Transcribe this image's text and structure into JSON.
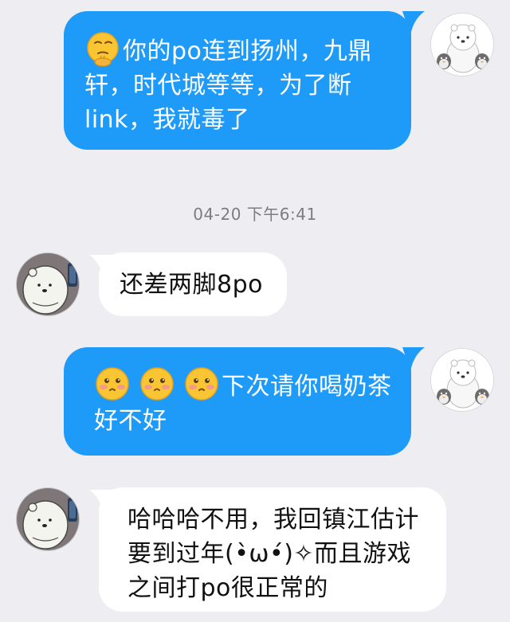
{
  "chat": {
    "timestamp": "04-20 下午6:41",
    "messages": [
      {
        "side": "out",
        "emoji_icon": "thinking-chin-emoji",
        "text": "你的po连到扬州，九鼎轩，时代城等等，为了断link，我就毒了"
      },
      {
        "side": "in",
        "text": "还差两脚8po"
      },
      {
        "side": "out",
        "emoji_icon": "blushing-face-emoji",
        "emoji_count": 3,
        "text": "下次请你喝奶茶好不好"
      },
      {
        "side": "in",
        "text": "哈哈哈不用，我回镇江估计要到过年(•̀ω•́)✧而且游戏之间打po很正常的"
      }
    ],
    "avatars": {
      "self": "polar-bear-penguins-avatar",
      "other": "ice-bear-avatar"
    },
    "colors": {
      "background": "#ededf2",
      "outgoing_bubble": "#1e9bf8",
      "incoming_bubble": "#ffffff"
    }
  }
}
